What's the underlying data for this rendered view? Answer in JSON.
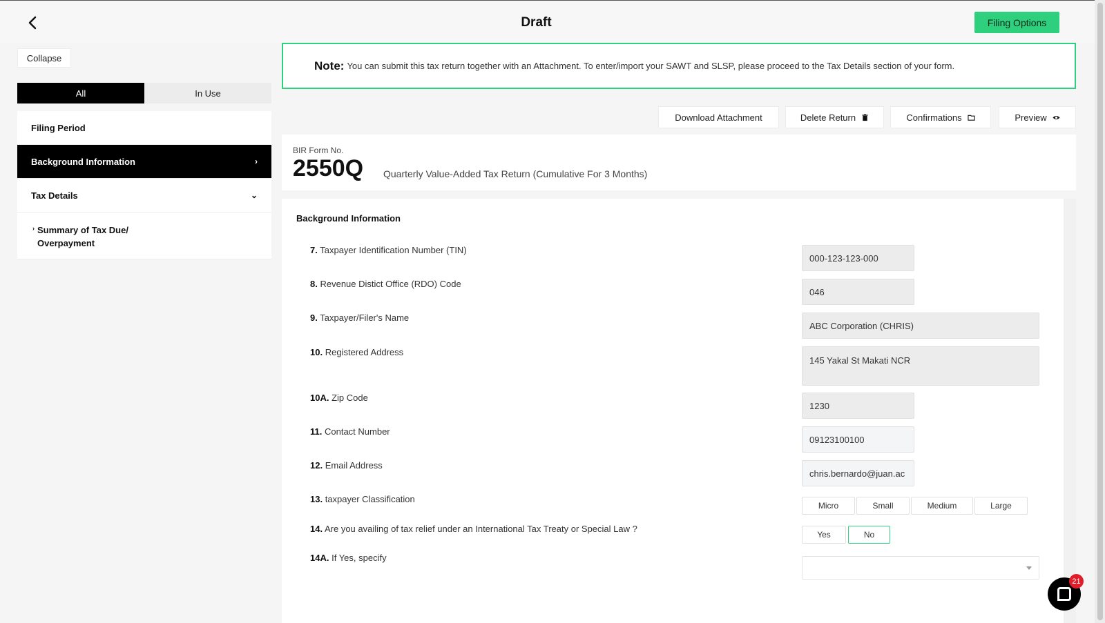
{
  "header": {
    "title": "Draft",
    "filing_options_label": "Filing Options"
  },
  "sidebar": {
    "collapse_label": "Collapse",
    "filters": [
      {
        "label": "All",
        "active": true
      },
      {
        "label": "In Use",
        "active": false
      }
    ],
    "items": [
      {
        "label": "Filing Period"
      },
      {
        "label": "Background Information",
        "chevron": "›"
      },
      {
        "label": "Tax Details",
        "chevron": "⌄"
      }
    ],
    "sub_item": {
      "prefix": "›",
      "label": "Summary of Tax Due/ Overpayment"
    }
  },
  "note": {
    "title": "Note:",
    "text": "You can submit this tax return together with an Attachment. To enter/import your SAWT and SLSP, please proceed to the Tax Details section of your form."
  },
  "actions": {
    "download_attachment": "Download Attachment",
    "delete_return": "Delete Return",
    "confirmations": "Confirmations",
    "preview": "Preview"
  },
  "bir": {
    "label": "BIR Form No.",
    "number": "2550Q",
    "description": "Quarterly Value-Added Tax Return (Cumulative For 3 Months)"
  },
  "form": {
    "section_title": "Background Information",
    "fields": {
      "tin": {
        "num": "7.",
        "label": "Taxpayer Identification Number (TIN)",
        "value": "000-123-123-000"
      },
      "rdo": {
        "num": "8.",
        "label": "Revenue Distict Office (RDO) Code",
        "value": "046"
      },
      "name": {
        "num": "9.",
        "label": "Taxpayer/Filer's Name",
        "value": "ABC Corporation (CHRIS)"
      },
      "address": {
        "num": "10.",
        "label": "Registered Address",
        "value": "145 Yakal St Makati NCR"
      },
      "zip": {
        "num": "10A.",
        "label": "Zip Code",
        "value": "1230"
      },
      "contact": {
        "num": "11.",
        "label": "Contact Number",
        "value": "09123100100"
      },
      "email": {
        "num": "12.",
        "label": "Email Address",
        "value": "chris.bernardo@juan.ac"
      },
      "classification": {
        "num": "13.",
        "label": "taxpayer Classification",
        "options": [
          "Micro",
          "Small",
          "Medium",
          "Large"
        ]
      },
      "tax_relief": {
        "num": "14.",
        "label": "Are you availing of tax relief under an International Tax Treaty or Special Law ?",
        "options": [
          "Yes",
          "No"
        ],
        "selected": "No"
      },
      "specify": {
        "num": "14A.",
        "label": "If Yes, specify",
        "value": ""
      }
    }
  },
  "chat": {
    "badge": "21"
  },
  "colors": {
    "accent": "#2ed07e",
    "active_nav": "#000000",
    "badge": "#e11d2a"
  }
}
